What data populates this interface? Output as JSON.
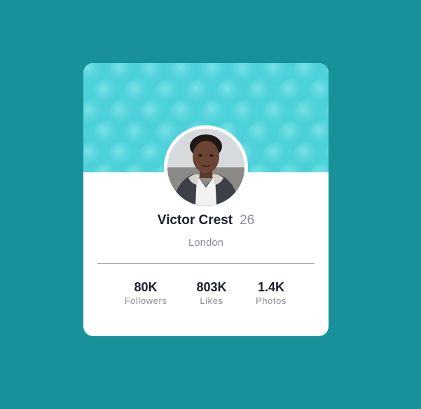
{
  "profile": {
    "name": "Victor Crest",
    "age": "26",
    "city": "London"
  },
  "stats": [
    {
      "value": "80K",
      "label": "Followers"
    },
    {
      "value": "803K",
      "label": "Likes"
    },
    {
      "value": "1.4K",
      "label": "Photos"
    }
  ],
  "colors": {
    "page_background": "#19919a",
    "banner": "#4cd2da",
    "card": "#ffffff",
    "primary_text": "#1b1f2a",
    "muted_text": "#8d8d95"
  },
  "icons": {
    "banner": "bubble-pattern",
    "avatar": "user-photo"
  }
}
